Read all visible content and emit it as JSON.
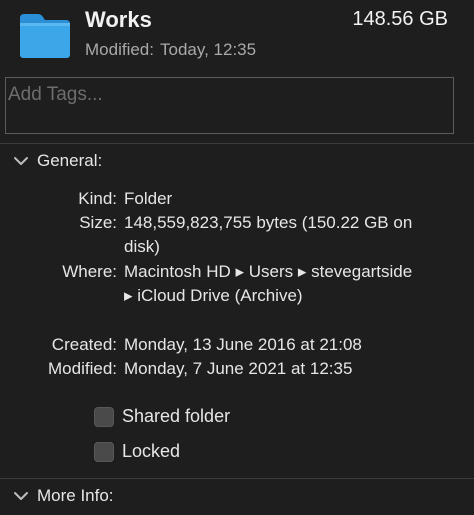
{
  "header": {
    "title": "Works",
    "total_size": "148.56 GB",
    "modified_label": "Modified:",
    "modified_value": "Today, 12:35",
    "folder_icon": "folder-icon",
    "folder_color": "#3ba6e8"
  },
  "tags": {
    "placeholder": "Add Tags..."
  },
  "general": {
    "label": "General:",
    "rows": [
      {
        "label": "Kind:",
        "value": "Folder"
      },
      {
        "label": "Size:",
        "value": "148,559,823,755 bytes (150.22 GB on disk)"
      },
      {
        "label": "Where:",
        "value": "Macintosh HD ▸ Users ▸ stevegartside ▸ iCloud Drive (Archive)"
      },
      {
        "label": "Created:",
        "value": "Monday, 13 June 2016 at 21:08"
      },
      {
        "label": "Modified:",
        "value": "Monday, 7 June 2021 at 12:35"
      }
    ],
    "shared_folder_label": "Shared folder",
    "locked_label": "Locked"
  },
  "more_info": {
    "label": "More Info:"
  }
}
